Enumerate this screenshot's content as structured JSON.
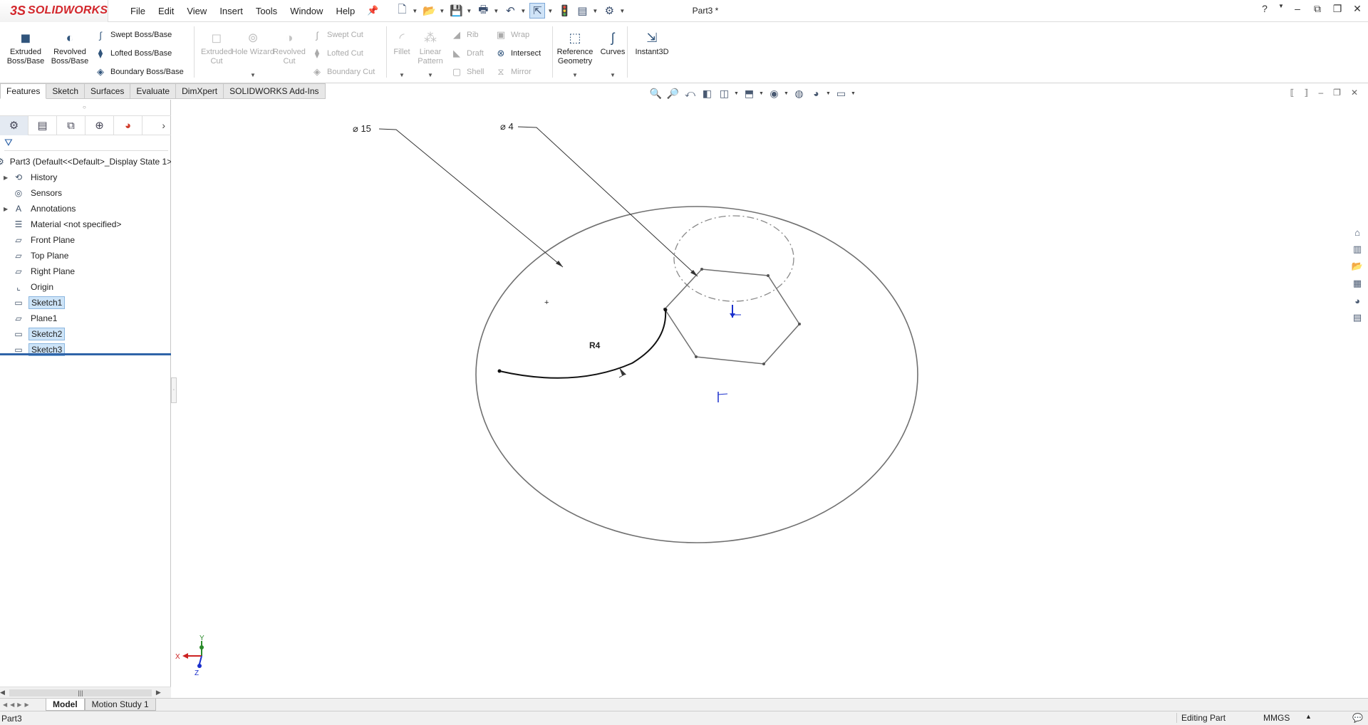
{
  "app": {
    "logo_ds": "3S",
    "logo_name": "SOLIDWORKS",
    "doc_title": "Part3 *"
  },
  "menus": [
    "File",
    "Edit",
    "View",
    "Insert",
    "Tools",
    "Window",
    "Help"
  ],
  "ribbon": {
    "extruded_boss": "Extruded Boss/Base",
    "revolved_boss": "Revolved Boss/Base",
    "swept_boss": "Swept Boss/Base",
    "lofted_boss": "Lofted Boss/Base",
    "boundary_boss": "Boundary Boss/Base",
    "extruded_cut": "Extruded Cut",
    "hole_wizard": "Hole Wizard",
    "revolved_cut": "Revolved Cut",
    "swept_cut": "Swept Cut",
    "lofted_cut": "Lofted Cut",
    "boundary_cut": "Boundary Cut",
    "fillet": "Fillet",
    "linear_pattern": "Linear Pattern",
    "rib": "Rib",
    "draft": "Draft",
    "shell": "Shell",
    "wrap": "Wrap",
    "intersect": "Intersect",
    "mirror": "Mirror",
    "reference_geometry": "Reference Geometry",
    "curves": "Curves",
    "instant3d": "Instant3D"
  },
  "tabs": [
    "Features",
    "Sketch",
    "Surfaces",
    "Evaluate",
    "DimXpert",
    "SOLIDWORKS Add-Ins"
  ],
  "tree": {
    "root": "Part3  (Default<<Default>_Display State 1>)",
    "items": [
      {
        "label": "History",
        "expandable": true,
        "icon": "history-icon"
      },
      {
        "label": "Sensors",
        "expandable": false,
        "icon": "sensor-icon"
      },
      {
        "label": "Annotations",
        "expandable": true,
        "icon": "annotation-icon"
      },
      {
        "label": "Material <not specified>",
        "expandable": false,
        "icon": "material-icon"
      },
      {
        "label": "Front Plane",
        "expandable": false,
        "icon": "plane-icon"
      },
      {
        "label": "Top Plane",
        "expandable": false,
        "icon": "plane-icon"
      },
      {
        "label": "Right Plane",
        "expandable": false,
        "icon": "plane-icon"
      },
      {
        "label": "Origin",
        "expandable": false,
        "icon": "origin-icon"
      },
      {
        "label": "Sketch1",
        "expandable": false,
        "icon": "sketch-icon",
        "highlighted": true
      },
      {
        "label": "Plane1",
        "expandable": false,
        "icon": "plane-icon"
      },
      {
        "label": "Sketch2",
        "expandable": false,
        "icon": "sketch-icon",
        "highlighted": true
      },
      {
        "label": "Sketch3",
        "expandable": false,
        "icon": "sketch-icon",
        "highlighted": true
      }
    ]
  },
  "dimensions": {
    "d15": "⌀ 15",
    "d4": "⌀ 4",
    "r4": "R4"
  },
  "triad": {
    "x": "X",
    "y": "Y",
    "z": "Z"
  },
  "model_tabs": [
    "Model",
    "Motion Study 1"
  ],
  "status": {
    "left": "Part3",
    "mode": "Editing Part",
    "units": "MMGS"
  },
  "colors": {
    "brand": "#d3262b",
    "selection": "#cde4f8",
    "sketch_line": "#707070",
    "origin": "#1a2fcc"
  }
}
